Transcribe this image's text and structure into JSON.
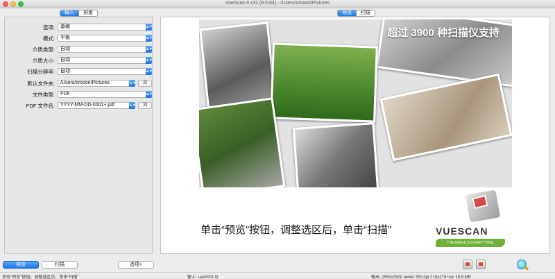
{
  "window": {
    "title": "VueScan 9 x32 (9.5.84) - /Users/orsoon/Pictures"
  },
  "left_tabs": [
    {
      "label": "输入",
      "active": true
    },
    {
      "label": "预置",
      "active": false
    }
  ],
  "preview_tabs": [
    {
      "label": "预览",
      "active": true
    },
    {
      "label": "扫描",
      "active": false
    }
  ],
  "settings": [
    {
      "label": "选项:",
      "value": "基础"
    },
    {
      "label": "模式:",
      "value": "平板"
    },
    {
      "label": "介质类型:",
      "value": "自动"
    },
    {
      "label": "介质大小:",
      "value": "自动"
    },
    {
      "label": "扫描分辨率:",
      "value": "自动"
    },
    {
      "label": "默认文件夹:",
      "value": "/Users/orsoon/Pictures",
      "button": "浏"
    },
    {
      "label": "文件类型:",
      "value": "PDF"
    },
    {
      "label": "PDF 文件名:",
      "value": "YYYY-MM-DD-0001+.pdf",
      "button": "浏"
    }
  ],
  "preview": {
    "banner": "超过 3900 种扫描仪支持",
    "instruction": "单击“预览”按钮，调整选区后，单击“扫描”",
    "logo_text": "VUESCAN",
    "logo_tagline": "THE IMAGE IS EVERYTHING"
  },
  "buttons": {
    "preview": "预览",
    "scan": "扫描",
    "options": "选项+"
  },
  "icons": {
    "scan_icon_1": "scanner-icon",
    "scan_icon_2": "scanner-icon",
    "zoom": "zoom-in-icon"
  },
  "status": {
    "left": "单击\"预览\"按钮，调整选区后，单击\"扫描\"",
    "input": "输入: raw0001.tif",
    "output": "输出: 2550x3300 pixels 300 dpi 216x279 mm 18.9 MB"
  },
  "colors": {
    "accent": "#1f74e6",
    "background": "#ececec"
  }
}
